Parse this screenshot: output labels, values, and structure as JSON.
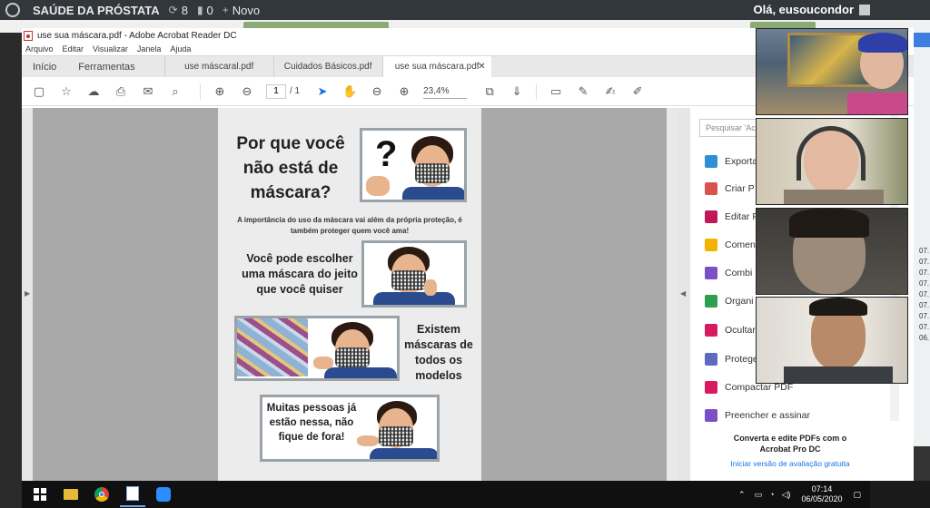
{
  "wp": {
    "site_name": "SAÚDE DA PRÓSTATA",
    "updates": "8",
    "comments": "0",
    "new_label": "Novo",
    "greeting": "Olá, eusoucondor"
  },
  "acrobat": {
    "title": "use sua máscara.pdf - Adobe Acrobat Reader DC",
    "menu": [
      "Arquivo",
      "Editar",
      "Visualizar",
      "Janela",
      "Ajuda"
    ],
    "tabs": {
      "home": "Início",
      "tools": "Ferramentas",
      "docs": [
        "use máscaral.pdf",
        "Cuidados Básicos.pdf",
        "use sua máscara.pdf"
      ]
    },
    "page_current": "1",
    "page_total": "/ 1",
    "zoom": "23,4%"
  },
  "pdf": {
    "heading": "Por que você não está de máscara?",
    "subtitle": "A importância do uso da máscara vai além da própria proteção, é também proteger quem você ama!",
    "block2": "Você pode escolher uma máscara do jeito que você quiser",
    "block3": "Existem máscaras de todos os modelos",
    "block4": "Muitas pessoas já estão nessa, não fique de fora!",
    "question_mark": "?"
  },
  "tools_panel": {
    "search_placeholder": "Pesquisar 'Ac",
    "items": [
      {
        "label": "Exportar",
        "color": "#2d8fd5"
      },
      {
        "label": "Criar P",
        "color": "#d9534f"
      },
      {
        "label": "Editar P",
        "color": "#c2185b"
      },
      {
        "label": "Comen",
        "color": "#f2b400"
      },
      {
        "label": "Combi",
        "color": "#7b4fc6"
      },
      {
        "label": "Organi",
        "color": "#2e9e4f"
      },
      {
        "label": "Ocultar",
        "color": "#d81b60"
      },
      {
        "label": "Protege",
        "color": "#5c6bc0"
      },
      {
        "label": "Compactar PDF",
        "color": "#d81b60"
      },
      {
        "label": "Preencher e assinar",
        "color": "#7b4fc6"
      }
    ],
    "promo": "Converta e edite PDFs com o Acrobat Pro DC",
    "promo_link": "Iniciar versão de avaliação gratuita"
  },
  "taskbar": {
    "time": "07:14",
    "date": "06/05/2020"
  },
  "edge_text": [
    "07.",
    "07.",
    "07.",
    "07.",
    "07.",
    "07.",
    "07.",
    "07.",
    "06."
  ]
}
